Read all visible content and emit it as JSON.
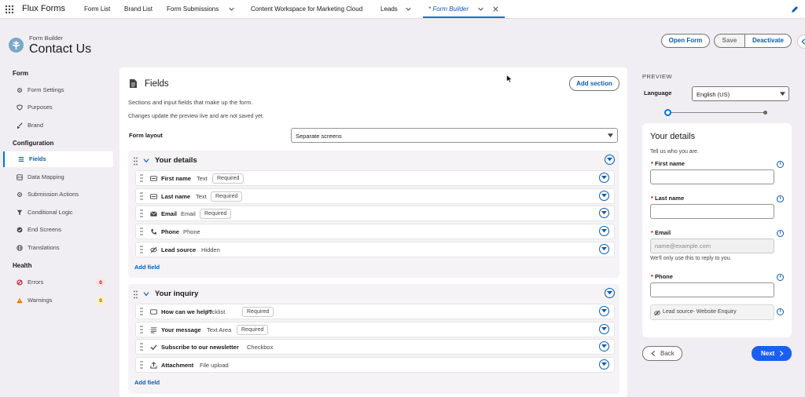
{
  "app": {
    "name": "Flux Forms"
  },
  "nav": {
    "items": [
      "Form List",
      "Brand List",
      "Form Submissions",
      "Content Workspace for Marketing Cloud",
      "Leads",
      "* Form Builder"
    ]
  },
  "header": {
    "subtitle": "Form Builder",
    "title": "Contact Us",
    "buttons": {
      "open_form": "Open Form",
      "save": "Save",
      "deactivate": "Deactivate"
    }
  },
  "sidebar": {
    "form_heading": "Form",
    "form_items": [
      "Form Settings",
      "Purposes",
      "Brand"
    ],
    "config_heading": "Configuration",
    "config_items": [
      "Fields",
      "Data Mapping",
      "Submission Actions",
      "Conditional Logic",
      "End Screens",
      "Translations"
    ],
    "health_heading": "Health",
    "health_items": [
      {
        "label": "Errors",
        "count": "0"
      },
      {
        "label": "Warnings",
        "count": "0"
      }
    ]
  },
  "main": {
    "title": "Fields",
    "add_section": "Add section",
    "desc1": "Sections and input fields that make up the form.",
    "desc2": "Changes update the preview live and are not saved yet.",
    "layout_label": "Form layout",
    "layout_value": "Separate screens",
    "add_field": "Add field",
    "required": "Required",
    "sections": [
      {
        "title": "Your details",
        "fields": [
          {
            "name": "First name",
            "type": "Text",
            "required": true,
            "icon": "text-icon"
          },
          {
            "name": "Last name",
            "type": "Text",
            "required": true,
            "icon": "text-icon"
          },
          {
            "name": "Email",
            "type": "Email",
            "required": true,
            "icon": "email-icon"
          },
          {
            "name": "Phone",
            "type": "Phone",
            "required": false,
            "icon": "phone-icon"
          },
          {
            "name": "Lead source",
            "type": "Hidden",
            "required": false,
            "icon": "hidden-icon"
          }
        ]
      },
      {
        "title": "Your inquiry",
        "fields": [
          {
            "name": "How can we help?",
            "type": "Picklist",
            "required": true,
            "icon": "picklist-icon"
          },
          {
            "name": "Your message",
            "type": "Text Area",
            "required": true,
            "icon": "textarea-icon"
          },
          {
            "name": "Subscribe to our newsletter",
            "type": "Checkbox",
            "required": false,
            "icon": "check-icon"
          },
          {
            "name": "Attachment",
            "type": "File upload",
            "required": false,
            "icon": "upload-icon"
          }
        ]
      }
    ]
  },
  "preview": {
    "label": "PREVIEW",
    "language_label": "Language",
    "language_value": "English (US)",
    "card_title": "Your details",
    "card_desc": "Tell us who you are.",
    "fields": {
      "first_name": "First name",
      "last_name": "Last name",
      "email": "Email",
      "email_placeholder": "name@example.com",
      "email_help": "We'll only use this to reply to you.",
      "phone": "Phone",
      "hidden": "Lead source- Website Enquiry"
    },
    "back": "Back",
    "next": "Next"
  },
  "colors": {
    "accent": "#0176d3",
    "brand": "#0b5cab",
    "next_btn": "#1b5ff0"
  }
}
